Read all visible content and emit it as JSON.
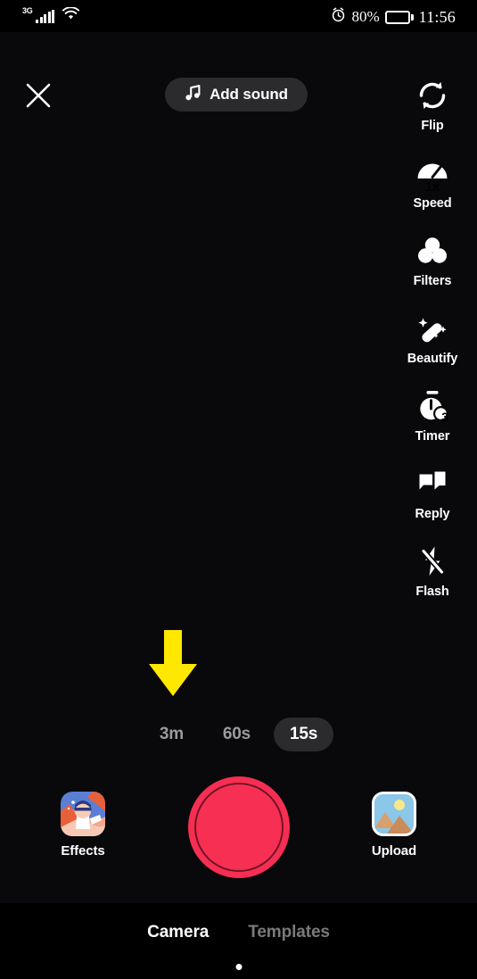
{
  "status_bar": {
    "network_type": "3G",
    "signal_icon": "signal-bars-icon",
    "wifi_icon": "wifi-icon",
    "alarm_icon": "alarm-clock-icon",
    "battery_percent": "80%",
    "battery_level": 80,
    "battery_icon": "battery-icon",
    "time": "11:56"
  },
  "top_bar": {
    "close_icon": "close-icon",
    "add_sound": {
      "icon": "music-note-icon",
      "label": "Add sound"
    }
  },
  "tool_rail": [
    {
      "icon": "flip-camera-icon",
      "label": "Flip",
      "badge": ""
    },
    {
      "icon": "speedometer-icon",
      "label": "Speed",
      "badge": "1x"
    },
    {
      "icon": "filters-icon",
      "label": "Filters",
      "badge": ""
    },
    {
      "icon": "magic-wand-icon",
      "label": "Beautify",
      "badge": ""
    },
    {
      "icon": "stopwatch-icon",
      "label": "Timer",
      "badge": "3"
    },
    {
      "icon": "reply-icon",
      "label": "Reply",
      "badge": ""
    },
    {
      "icon": "flash-off-icon",
      "label": "Flash",
      "badge": ""
    }
  ],
  "annotation": {
    "type": "arrow-down",
    "color": "#FFE800",
    "points_at": "60s"
  },
  "durations": {
    "options": [
      {
        "label": "3m",
        "selected": false
      },
      {
        "label": "60s",
        "selected": false
      },
      {
        "label": "15s",
        "selected": true
      }
    ],
    "selected": "15s"
  },
  "capture": {
    "effects": {
      "icon": "effects-thumbnail-icon",
      "label": "Effects"
    },
    "shutter": {
      "icon": "record-button",
      "color": "#F62F53"
    },
    "upload": {
      "icon": "image-thumbnail-icon",
      "label": "Upload"
    }
  },
  "bottom_tabs": {
    "items": [
      {
        "label": "Camera",
        "active": true
      },
      {
        "label": "Templates",
        "active": false
      }
    ],
    "home_indicator": "home-indicator-dot"
  },
  "colors": {
    "accent_record": "#F62F53",
    "annotation_yellow": "#FFE800",
    "pill_bg": "#2B2B2D",
    "inactive_text": "#9B9B9E",
    "viewport_bg": "#09090B"
  }
}
